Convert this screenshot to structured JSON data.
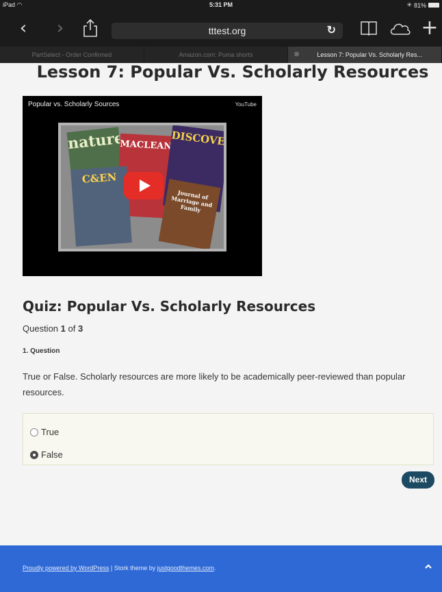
{
  "status_bar": {
    "device": "iPad",
    "wifi_icon": "wifi-icon",
    "time": "5:31 PM",
    "battery": "81%"
  },
  "browser": {
    "url": "tttest.org",
    "tabs": [
      {
        "label": "PartSelect - Order Confirmed"
      },
      {
        "label": "Amazon.com: Puma shorts"
      },
      {
        "label": "Lesson 7: Popular Vs. Scholarly Res..."
      }
    ]
  },
  "lesson": {
    "title": "Lesson 7: Popular Vs. Scholarly Resources",
    "video": {
      "title": "Popular vs. Scholarly Sources",
      "brand": "YouTube",
      "magazines": [
        "nature",
        "MACLEAN'S",
        "DISCOVER",
        "C&EN",
        "Journal of Marriage and Family"
      ]
    }
  },
  "quiz": {
    "title": "Quiz: Popular Vs. Scholarly Resources",
    "progress": {
      "prefix": "Question",
      "current": "1",
      "middle": "of",
      "total": "3"
    },
    "question_heading": "1. Question",
    "question_text": "True or False. Scholarly resources are more likely to be academically peer-reviewed than popular resources.",
    "options": [
      {
        "label": "True",
        "selected": false
      },
      {
        "label": "False",
        "selected": true
      }
    ],
    "next_label": "Next"
  },
  "footer": {
    "powered_link": "Proudly powered by WordPress",
    "separator": " | Stork theme by ",
    "theme_link": "justgoodthemes.com",
    "end": "."
  },
  "colors": {
    "footer_bg": "#2f69d6",
    "next_button": "#1c4a62",
    "play_button": "#e52d27"
  }
}
